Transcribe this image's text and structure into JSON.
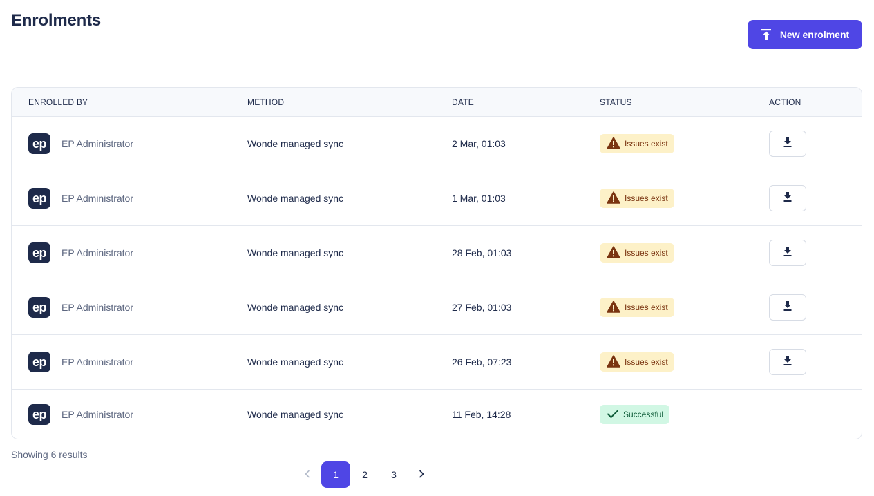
{
  "page": {
    "title": "Enrolments"
  },
  "header": {
    "new_button_label": "New enrolment"
  },
  "table": {
    "columns": [
      "ENROLLED BY",
      "METHOD",
      "DATE",
      "STATUS",
      "ACTION"
    ],
    "rows": [
      {
        "avatar": "ep",
        "enrolled_by": "EP Administrator",
        "method": "Wonde managed sync",
        "date": "2 Mar, 01:03",
        "status": "Issues exist",
        "status_type": "warning",
        "download": true
      },
      {
        "avatar": "ep",
        "enrolled_by": "EP Administrator",
        "method": "Wonde managed sync",
        "date": "1 Mar, 01:03",
        "status": "Issues exist",
        "status_type": "warning",
        "download": true
      },
      {
        "avatar": "ep",
        "enrolled_by": "EP Administrator",
        "method": "Wonde managed sync",
        "date": "28 Feb, 01:03",
        "status": "Issues exist",
        "status_type": "warning",
        "download": true
      },
      {
        "avatar": "ep",
        "enrolled_by": "EP Administrator",
        "method": "Wonde managed sync",
        "date": "27 Feb, 01:03",
        "status": "Issues exist",
        "status_type": "warning",
        "download": true
      },
      {
        "avatar": "ep",
        "enrolled_by": "EP Administrator",
        "method": "Wonde managed sync",
        "date": "26 Feb, 07:23",
        "status": "Issues exist",
        "status_type": "warning",
        "download": true
      },
      {
        "avatar": "ep",
        "enrolled_by": "EP Administrator",
        "method": "Wonde managed sync",
        "date": "11 Feb, 14:28",
        "status": "Successful",
        "status_type": "success",
        "download": false
      }
    ]
  },
  "footer": {
    "results_text": "Showing 6 results"
  },
  "pagination": {
    "pages": [
      "1",
      "2",
      "3"
    ],
    "current": "1"
  },
  "icons": {
    "new_button": "upload-icon",
    "warning": "warning-triangle-icon",
    "success": "check-icon",
    "download": "download-icon",
    "prev": "chevron-left-icon",
    "next": "chevron-right-icon"
  },
  "colors": {
    "accent": "#4f46e5",
    "warning_bg": "#fdf1c8",
    "warning_text": "#7a3410",
    "success_bg": "#d1f7e4",
    "success_text": "#115e3b",
    "avatar_bg": "#1e2a4a"
  }
}
